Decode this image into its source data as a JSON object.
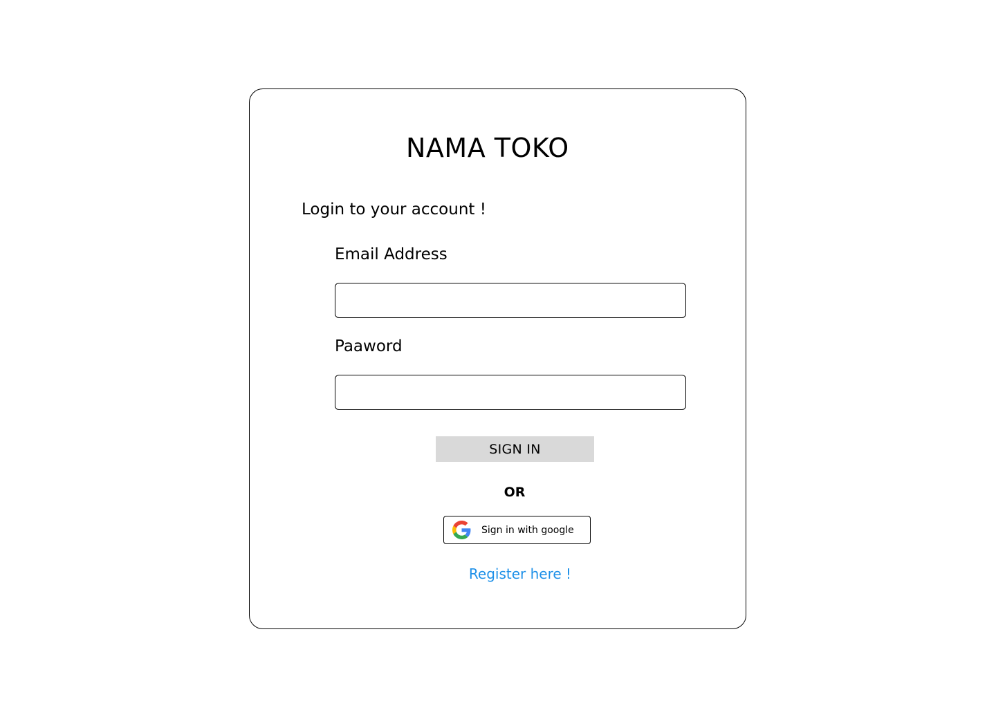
{
  "header": {
    "store_name": "NAMA TOKO"
  },
  "login": {
    "subtitle": "Login to your account !",
    "email_label": "Email Address",
    "email_value": "",
    "email_placeholder": "",
    "password_label": "Paaword",
    "password_value": "",
    "password_placeholder": "",
    "signin_label": "SIGN IN",
    "or_label": "OR",
    "google_label": "Sign in with google",
    "google_icon": "google-g-icon",
    "register_label": "Register here !"
  },
  "colors": {
    "signin_bg": "#d9d9d9",
    "link": "#1e90e8",
    "border": "#000000"
  }
}
